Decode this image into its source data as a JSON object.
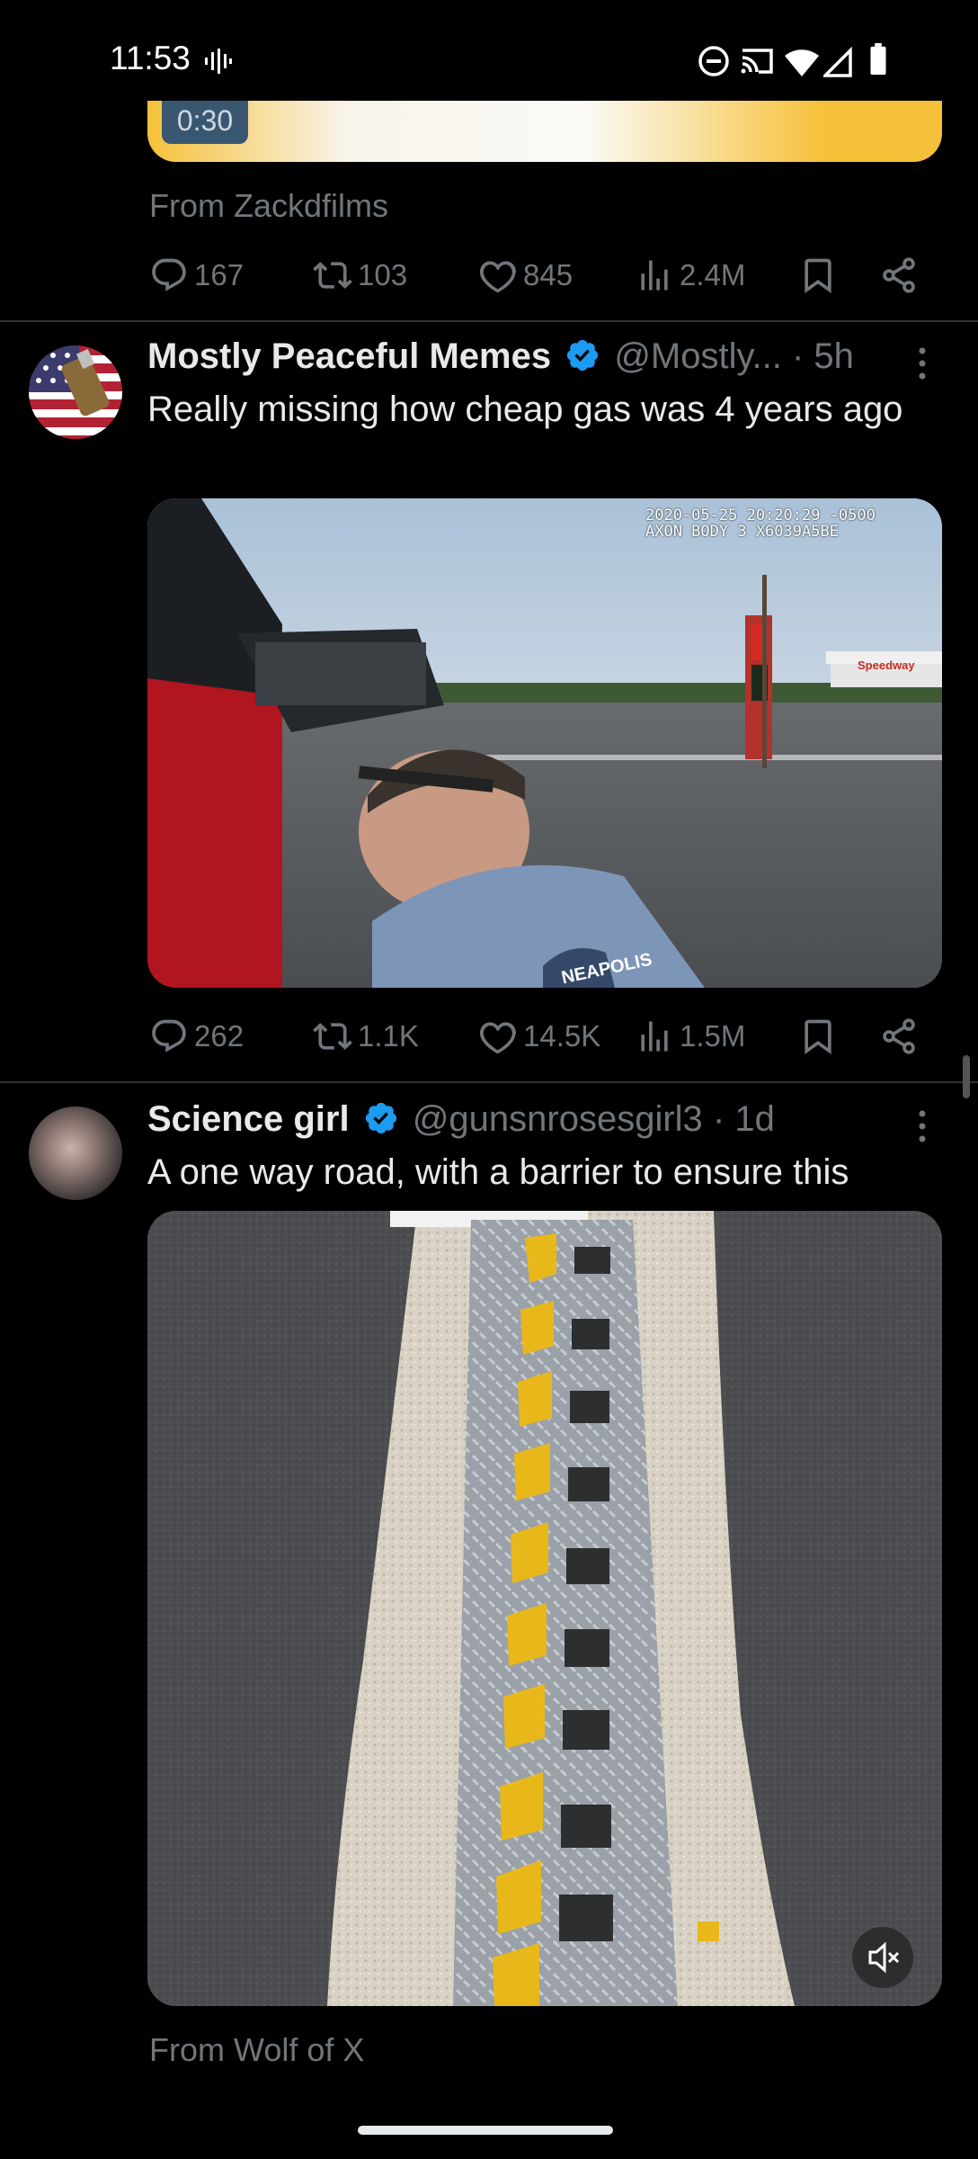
{
  "status_bar": {
    "time": "11:53",
    "icons": [
      "voice-indicator-icon",
      "do-not-disturb-icon",
      "cast-icon",
      "wifi-icon",
      "signal-icon",
      "battery-icon"
    ]
  },
  "prev_tweet": {
    "video_time": "0:30",
    "caption": "From Zackdfilms",
    "actions": {
      "replies": "167",
      "reposts": "103",
      "likes": "845",
      "views": "2.4M"
    }
  },
  "tweet1": {
    "name": "Mostly Peaceful Memes",
    "handle": "@Mostly...",
    "time": "· 5h",
    "text": "Really missing how cheap gas was 4 years ago",
    "media": {
      "bodycam_stamp_1": "2020-05-25 20:20:29 -0500",
      "bodycam_stamp_2": "AXON BODY 3 X6039A5BE",
      "sign_text": "Speedway",
      "patch_text": "NEAPOLIS"
    },
    "actions": {
      "replies": "262",
      "reposts": "1.1K",
      "likes": "14.5K",
      "views": "1.5M"
    }
  },
  "tweet2": {
    "name": "Science girl",
    "handle": "@gunsnrosesgirl3",
    "time": "· 1d",
    "text": "A one way road, with a barrier to ensure this",
    "caption": "From Wolf of X"
  },
  "colors": {
    "accent": "#1d9bf0",
    "muted": "#71767b",
    "text": "#e7e9ea",
    "bg": "#000000"
  }
}
